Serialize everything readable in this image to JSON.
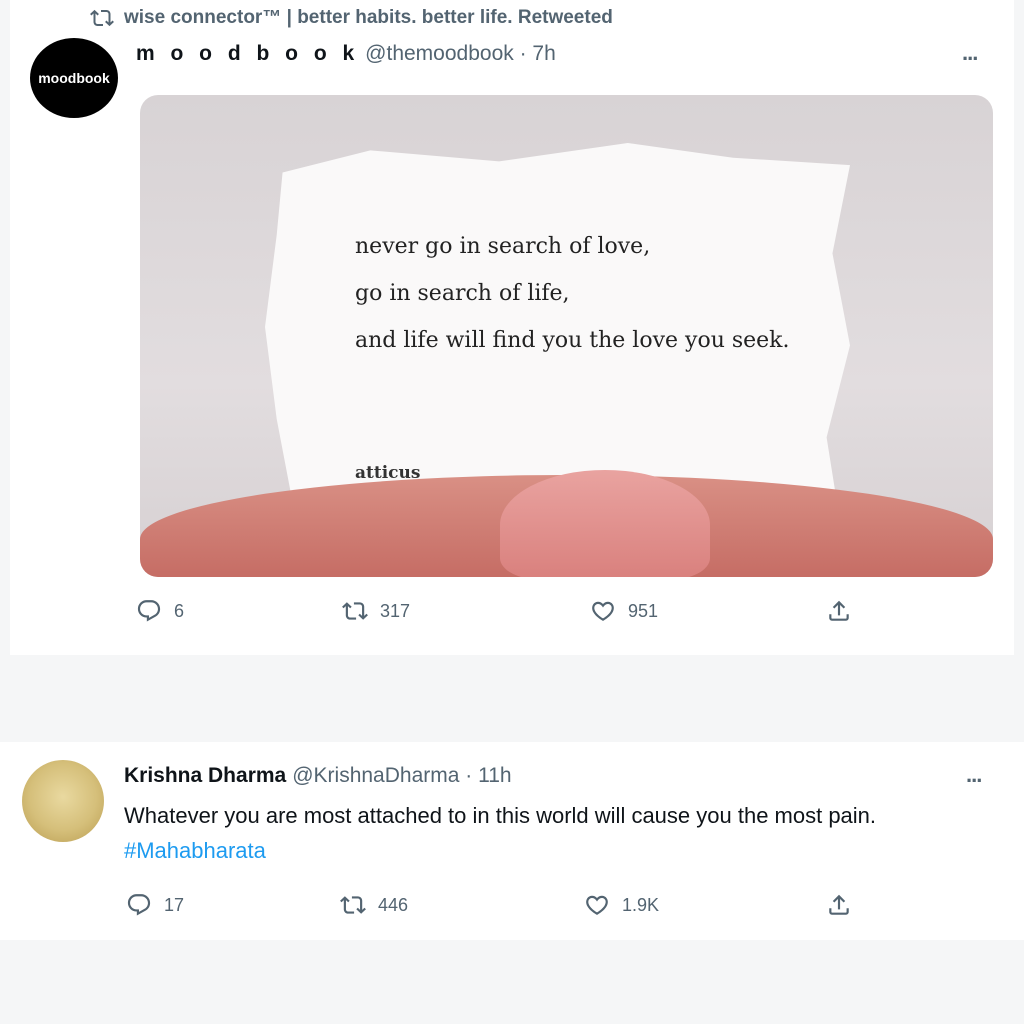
{
  "tweet1": {
    "retweet_label": "wise connector™ | better habits. better life. Retweeted",
    "avatar_text": "moodbook",
    "name": "m o o d b o o k",
    "handle_time": "@themoodbook · 7h",
    "more": "...",
    "image_quote": [
      "never go in search of love,",
      "go in search of life,",
      "and life will find you the love you seek."
    ],
    "image_author": "atticus",
    "replies": "6",
    "retweets": "317",
    "likes": "951"
  },
  "tweet2": {
    "name": "Krishna Dharma",
    "handle_time": "@KrishnaDharma · 11h",
    "more": "...",
    "text": "Whatever you are most attached to in this world will cause you the most pain.",
    "hashtag": "#Mahabharata",
    "replies": "17",
    "retweets": "446",
    "likes": "1.9K"
  },
  "icons": [
    "retweet-icon",
    "reply-icon",
    "like-icon",
    "share-icon",
    "more-icon"
  ],
  "colors": {
    "link": "#1d9bf0",
    "muted": "#536471",
    "text": "#0f1419"
  }
}
